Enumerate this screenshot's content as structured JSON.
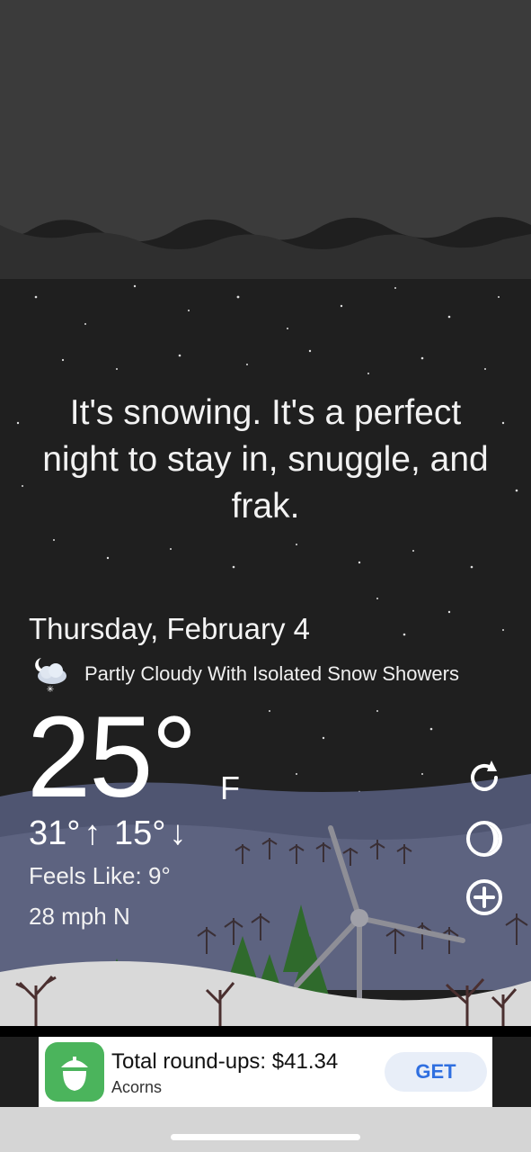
{
  "message": "It's snowing. It's a perfect night to stay in, snuggle, and frak.",
  "weather": {
    "date": "Thursday, February 4",
    "condition": "Partly Cloudy With Isolated Snow Showers",
    "condition_icon": "moon-cloud-snow-icon",
    "temperature": "25°",
    "unit": "F",
    "high": "31°",
    "low": "15°",
    "feels_like": "Feels Like: 9°",
    "wind": "28 mph N"
  },
  "actions": {
    "refresh_icon": "refresh-icon",
    "moon_icon": "moon-phase-icon",
    "add_icon": "add-icon"
  },
  "ad": {
    "title": "Total round-ups: $41.34",
    "subtitle": "Acorns",
    "cta": "GET",
    "icon": "acorn-icon",
    "brand_color": "#4bb45c"
  },
  "colors": {
    "sky": "#1f1f1f",
    "hills": "#5d6380",
    "snow_ground": "#d9d9d9",
    "trees": "#2f6a2c"
  }
}
